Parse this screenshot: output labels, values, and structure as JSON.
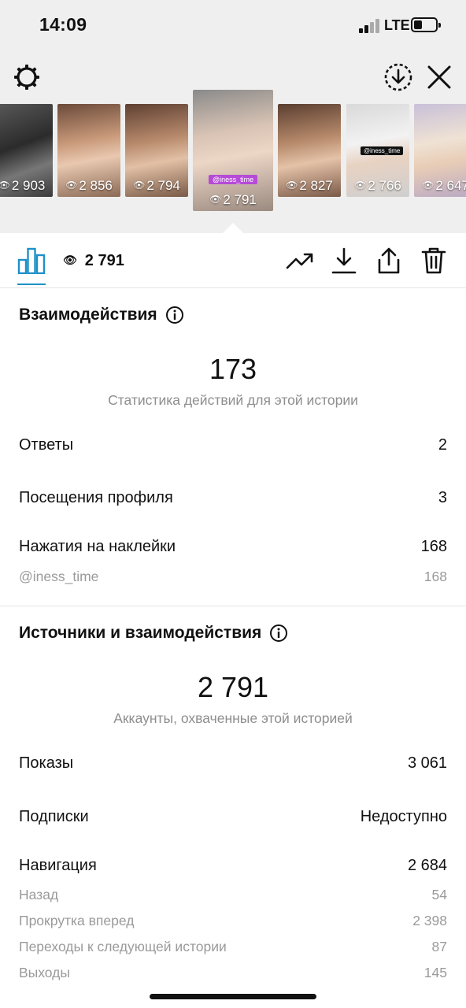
{
  "status_bar": {
    "time": "14:09",
    "network": "LTE"
  },
  "thumbnails": [
    {
      "views": "2 903"
    },
    {
      "views": "2 856"
    },
    {
      "views": "2 794"
    },
    {
      "views": "2 791",
      "sticker": "@iness_time"
    },
    {
      "views": "2 827"
    },
    {
      "views": "2 766",
      "sticker": "@iness_time"
    },
    {
      "views": "2 647"
    }
  ],
  "toolbar": {
    "view_count": "2 791"
  },
  "interactions": {
    "title": "Взаимодействия",
    "total": "173",
    "caption": "Статистика действий для этой истории",
    "rows": [
      {
        "label": "Ответы",
        "value": "2"
      },
      {
        "label": "Посещения профиля",
        "value": "3"
      },
      {
        "label": "Нажатия на наклейки",
        "value": "168"
      }
    ],
    "sub_rows": [
      {
        "label": "@iness_time",
        "value": "168"
      }
    ]
  },
  "discovery": {
    "title": "Источники и взаимодействия",
    "total": "2 791",
    "caption": "Аккаунты, охваченные этой историей",
    "rows": [
      {
        "label": "Показы",
        "value": "3 061"
      },
      {
        "label": "Подписки",
        "value": "Недоступно"
      },
      {
        "label": "Навигация",
        "value": "2 684"
      }
    ],
    "sub_rows": [
      {
        "label": "Назад",
        "value": "54"
      },
      {
        "label": "Прокрутка вперед",
        "value": "2 398"
      },
      {
        "label": "Переходы к следующей истории",
        "value": "87"
      },
      {
        "label": "Выходы",
        "value": "145"
      }
    ]
  },
  "colors": {
    "accent": "#1e90c8",
    "muted": "#8e8e8e",
    "top_background": "#efefef"
  }
}
